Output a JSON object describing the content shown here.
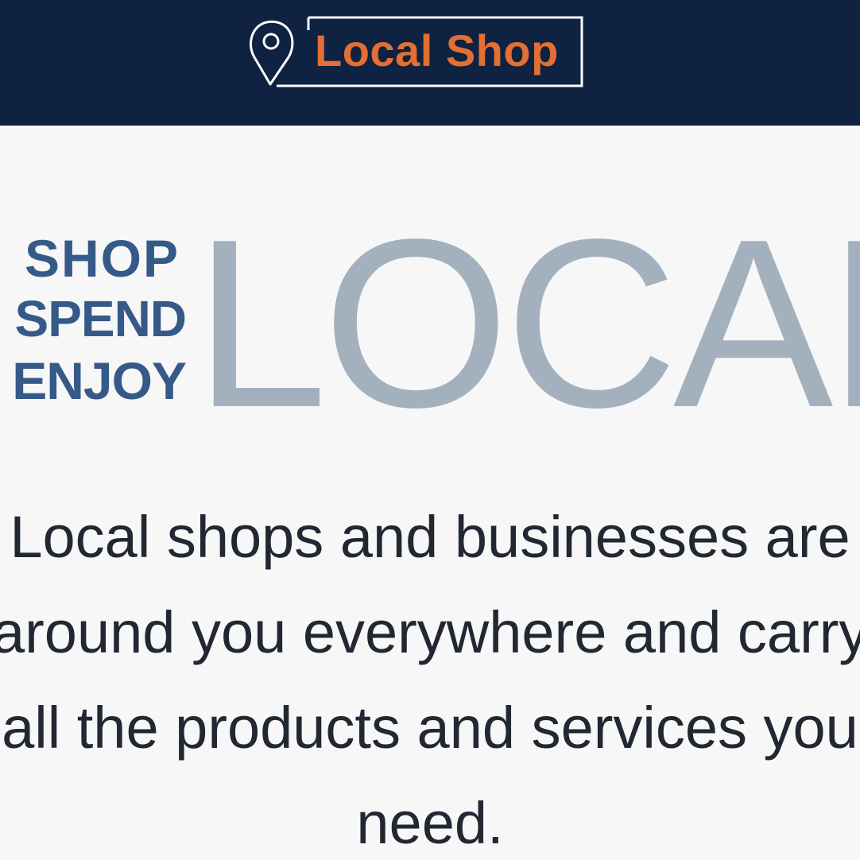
{
  "header": {
    "logo_text": "Local Shop",
    "icon": "location-pin-icon",
    "background_color": "#0f2241",
    "accent_color": "#e36f32"
  },
  "hero": {
    "tagline": [
      "SHOP",
      "SPEND",
      "ENJOY"
    ],
    "headline": "LOCAL",
    "tagline_color": "#355a88",
    "headline_color": "#a3b1bf"
  },
  "description": {
    "lines": [
      "Local shops and businesses are",
      "around you everywhere and carry",
      "all the products and services you",
      "need."
    ]
  }
}
